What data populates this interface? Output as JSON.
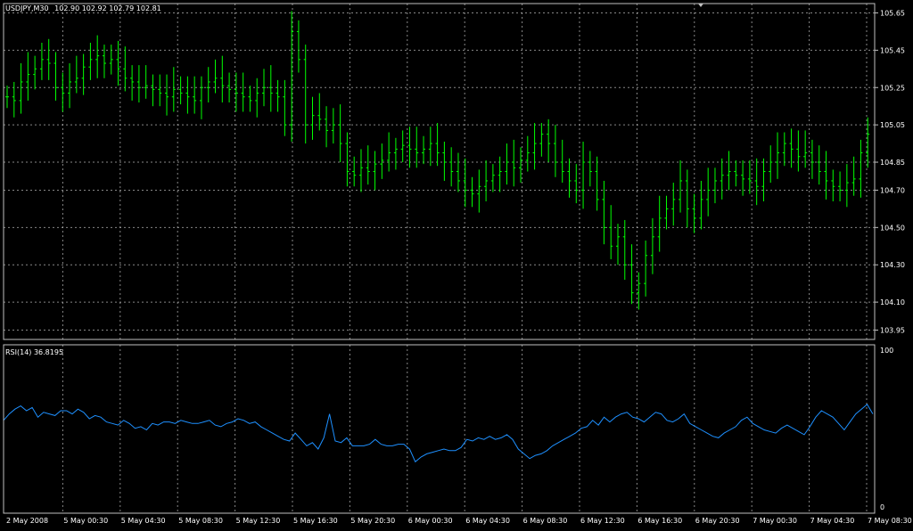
{
  "price_header": {
    "symbol_tf": "USDJPY,M30",
    "ohlc": "102.90 102.92 102.79 102.81"
  },
  "rsi_header": {
    "label": "RSI(14) 36.8195"
  },
  "colors": {
    "background": "#000000",
    "grid": "#c0c0c0",
    "bars": "#00ff00",
    "rsi_line": "#1e90ff",
    "text": "#ffffff"
  },
  "chart_data": [
    {
      "type": "line",
      "title": "USDJPY,M30",
      "y_ticks": [
        "105.65",
        "105.45",
        "105.25",
        "105.05",
        "104.85",
        "104.70",
        "104.50",
        "104.30",
        "104.10",
        "103.95"
      ],
      "ylim": [
        103.9,
        105.7
      ],
      "x_ticks": [
        "2 May 2008",
        "5 May 00:30",
        "5 May 04:30",
        "5 May 08:30",
        "5 May 12:30",
        "5 May 16:30",
        "5 May 20:30",
        "6 May 00:30",
        "6 May 04:30",
        "6 May 08:30",
        "6 May 12:30",
        "6 May 16:30",
        "6 May 20:30",
        "7 May 00:30",
        "7 May 04:30",
        "7 May 08:30"
      ],
      "grid": true,
      "series": [
        {
          "close": [
            105.2,
            105.18,
            105.28,
            105.32,
            105.35,
            105.4,
            105.38,
            105.25,
            105.22,
            105.28,
            105.3,
            105.36,
            105.4,
            105.42,
            105.38,
            105.4,
            105.35,
            105.3,
            105.28,
            105.25,
            105.26,
            105.24,
            105.22,
            105.2,
            105.24,
            105.22,
            105.2,
            105.18,
            105.25,
            105.28,
            105.3,
            105.26,
            105.24,
            105.22,
            105.2,
            105.18,
            105.22,
            105.25,
            105.22,
            105.2,
            105.05,
            105.55,
            105.4,
            105.05,
            105.1,
            105.08,
            105.02,
            105.05,
            104.95,
            104.8,
            104.78,
            104.82,
            104.8,
            104.84,
            104.86,
            104.9,
            104.92,
            104.94,
            104.92,
            104.9,
            104.92,
            104.95,
            104.9,
            104.85,
            104.8,
            104.75,
            104.7,
            104.68,
            104.72,
            104.75,
            104.78,
            104.8,
            104.85,
            104.82,
            104.86,
            104.9,
            104.95,
            105.0,
            104.95,
            104.85,
            104.8,
            104.75,
            104.7,
            104.85,
            104.8,
            104.65,
            104.5,
            104.4,
            104.45,
            104.3,
            104.15,
            104.2,
            104.35,
            104.45,
            104.55,
            104.6,
            104.65,
            104.75,
            104.6,
            104.55,
            104.65,
            104.7,
            104.75,
            104.78,
            104.8,
            104.78,
            104.76,
            104.75,
            104.72,
            104.8,
            104.85,
            104.9,
            104.95,
            104.92,
            104.88,
            104.9,
            104.85,
            104.8,
            104.75,
            104.72,
            104.7,
            104.74,
            104.76,
            104.9,
            105.0
          ]
        }
      ]
    },
    {
      "type": "line",
      "title": "RSI(14) 36.8195",
      "y_ticks": [
        "100",
        "0"
      ],
      "ylim": [
        0,
        100
      ],
      "grid": true,
      "series": [
        {
          "name": "RSI(14)",
          "values": [
            56,
            60,
            63,
            65,
            62,
            64,
            58,
            61,
            60,
            59,
            62,
            62,
            60,
            63,
            61,
            57,
            59,
            58,
            55,
            54,
            53,
            56,
            54,
            51,
            52,
            50,
            54,
            53,
            55,
            55,
            54,
            56,
            55,
            54,
            54,
            55,
            56,
            53,
            52,
            54,
            55,
            57,
            56,
            54,
            55,
            52,
            50,
            48,
            46,
            44,
            43,
            48,
            44,
            40,
            42,
            38,
            45,
            60,
            43,
            42,
            45,
            40,
            40,
            40,
            41,
            44,
            41,
            40,
            40,
            41,
            41,
            38,
            30,
            33,
            35,
            36,
            37,
            38,
            37,
            37,
            39,
            44,
            43,
            45,
            44,
            46,
            44,
            45,
            47,
            44,
            38,
            35,
            32,
            34,
            35,
            37,
            40,
            42,
            44,
            46,
            48,
            51,
            52,
            56,
            53,
            58,
            55,
            58,
            60,
            61,
            58,
            57,
            55,
            58,
            61,
            60,
            56,
            55,
            57,
            60,
            54,
            52,
            50,
            48,
            46,
            45,
            48,
            50,
            52,
            56,
            58,
            54,
            52,
            50,
            49,
            48,
            51,
            53,
            51,
            49,
            47,
            52,
            58,
            62,
            60,
            58,
            54,
            50,
            55,
            60,
            63,
            66,
            60
          ]
        }
      ]
    }
  ]
}
